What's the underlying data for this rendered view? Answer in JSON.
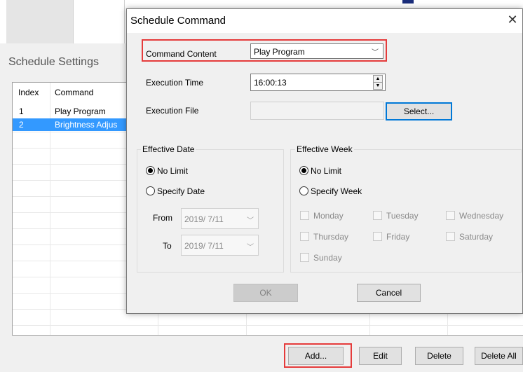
{
  "settings_window": {
    "title": "Schedule Settings",
    "columns": [
      "Index",
      "Command"
    ],
    "rows": [
      {
        "index": "1",
        "command": "Play Program"
      },
      {
        "index": "2",
        "command": "Brightness Adjus"
      }
    ],
    "buttons": {
      "add": "Add...",
      "edit": "Edit",
      "delete": "Delete",
      "delete_all": "Delete All"
    }
  },
  "dialog": {
    "title": "Schedule Command",
    "close_glyph": "✕",
    "command_content": {
      "label": "Command Content",
      "value": "Play Program"
    },
    "execution_time": {
      "label": "Execution Time",
      "value": "16:00:13"
    },
    "execution_file": {
      "label": "Execution File",
      "select_label": "Select..."
    },
    "effective_date": {
      "title": "Effective Date",
      "no_limit": "No Limit",
      "specify_date": "Specify Date",
      "from_label": "From",
      "from_value": "2019/ 7/11",
      "to_label": "To",
      "to_value": "2019/ 7/11",
      "selected": "no_limit"
    },
    "effective_week": {
      "title": "Effective Week",
      "no_limit": "No Limit",
      "specify_week": "Specify Week",
      "selected": "no_limit",
      "days": [
        "Monday",
        "Tuesday",
        "Wednesday",
        "Thursday",
        "Friday",
        "Saturday",
        "Sunday"
      ]
    },
    "ok_label": "OK",
    "cancel_label": "Cancel"
  },
  "colors": {
    "highlight": "#e53b3b",
    "selection": "#3399ff",
    "focus": "#0078d7"
  }
}
